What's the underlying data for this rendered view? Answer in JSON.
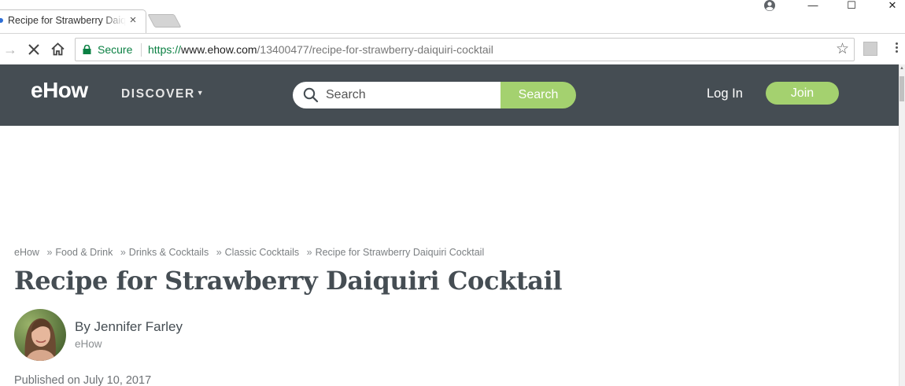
{
  "browser": {
    "tab_title": "Recipe for Strawberry Daiquiri Cocktail",
    "tab_close_glyph": "×",
    "window_controls": {
      "minimize": "—",
      "maximize": "☐",
      "close": "✕"
    },
    "secure_label": "Secure",
    "url": {
      "scheme": "https://",
      "host": "www.ehow.com",
      "path": "/13400477/recipe-for-strawberry-daiquiri-cocktail"
    }
  },
  "site_header": {
    "logo": "eHow",
    "discover_label": "DISCOVER",
    "search_placeholder": "Search",
    "search_button_label": "Search",
    "login_label": "Log In",
    "join_label": "Join",
    "colors": {
      "header_bg": "#454d53",
      "accent_green": "#a4d16f"
    }
  },
  "article": {
    "breadcrumb": [
      "eHow",
      "Food & Drink",
      "Drinks & Cocktails",
      "Classic Cocktails",
      "Recipe for Strawberry Daiquiri Cocktail"
    ],
    "breadcrumb_separator": "»",
    "title": "Recipe for Strawberry Daiquiri Cocktail",
    "author": "By Jennifer Farley",
    "author_org": "eHow",
    "published": "Published on July 10, 2017"
  }
}
